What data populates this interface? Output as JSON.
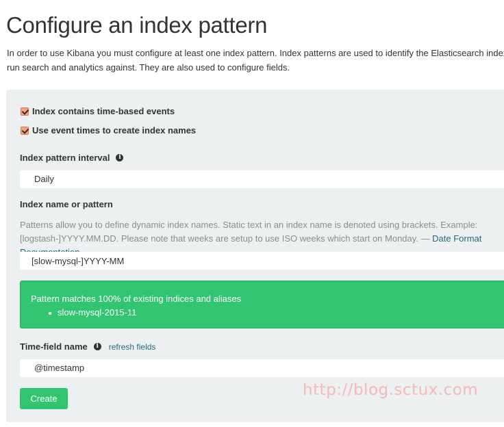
{
  "page": {
    "title": "Configure an index pattern",
    "intro": "In order to use Kibana you must configure at least one index pattern. Index patterns are used to identify the Elasticsearch index to run search and analytics against. They are also used to configure fields."
  },
  "form": {
    "time_based_label": "Index contains time-based events",
    "time_based_checked": true,
    "event_times_label": "Use event times to create index names",
    "event_times_checked": true,
    "interval_label": "Index pattern interval",
    "interval_value": "Daily",
    "pattern_label": "Index name or pattern",
    "pattern_help": "Patterns allow you to define dynamic index names. Static text in an index name is denoted using brackets. Example: [logstash-]YYYY.MM.DD. Please note that weeks are setup to use ISO weeks which start on Monday. — ",
    "pattern_help_link": "Date Format Documentation",
    "pattern_value": "[slow-mysql-]YYYY-MM",
    "match_message": "Pattern matches 100% of existing indices and aliases",
    "match_items": [
      "slow-mysql-2015-11"
    ],
    "time_field_label": "Time-field name",
    "refresh_link": "refresh fields",
    "time_field_value": "@timestamp",
    "create_label": "Create"
  },
  "watermark": "http://blog.sctux.com",
  "colors": {
    "panel": "#ecf0f1",
    "success": "#31c471",
    "link": "#1f6b7a",
    "checkbox": "#f0a381"
  },
  "icons": {
    "info": "info-circle-icon",
    "check": "checkmark-icon"
  }
}
